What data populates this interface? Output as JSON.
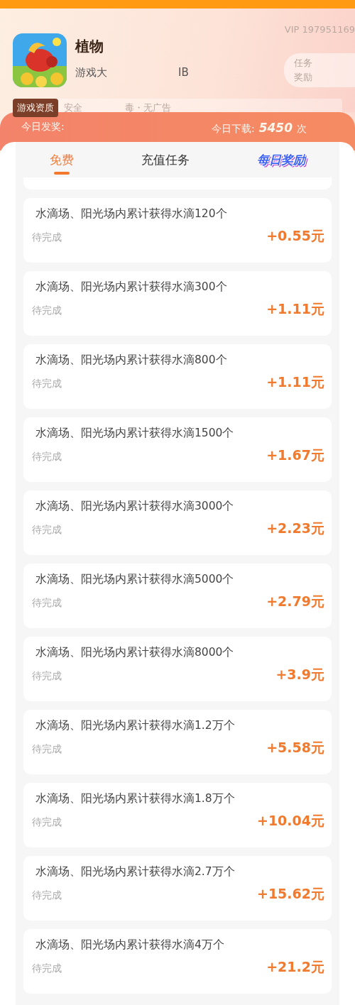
{
  "app": {
    "name": "植物",
    "subtitle_left": "游戏大",
    "subtitle_right": "IB",
    "vip": "VIP 197951169",
    "task_button": [
      "任务",
      "奖励"
    ]
  },
  "quality": {
    "label": "游戏资质",
    "left": "安全",
    "right": "毒・无广告"
  },
  "stats": {
    "award_label": "今日发奖:",
    "download_label": "今日下载:",
    "download_value": "5450",
    "download_unit": "次"
  },
  "tabs": [
    {
      "label": "免费",
      "selected": true,
      "kind": "plain"
    },
    {
      "label": "充值任务",
      "selected": false,
      "kind": "plain"
    },
    {
      "label": "每日奖励",
      "selected": false,
      "kind": "badge"
    }
  ],
  "tasks": [
    {
      "title": "水滴场、阳光场内累计获得水滴120个",
      "status": "待完成",
      "reward": "+0.55元"
    },
    {
      "title": "水滴场、阳光场内累计获得水滴300个",
      "status": "待完成",
      "reward": "+1.11元"
    },
    {
      "title": "水滴场、阳光场内累计获得水滴800个",
      "status": "待完成",
      "reward": "+1.11元"
    },
    {
      "title": "水滴场、阳光场内累计获得水滴1500个",
      "status": "待完成",
      "reward": "+1.67元"
    },
    {
      "title": "水滴场、阳光场内累计获得水滴3000个",
      "status": "待完成",
      "reward": "+2.23元"
    },
    {
      "title": "水滴场、阳光场内累计获得水滴5000个",
      "status": "待完成",
      "reward": "+2.79元"
    },
    {
      "title": "水滴场、阳光场内累计获得水滴8000个",
      "status": "待完成",
      "reward": "+3.9元"
    },
    {
      "title": "水滴场、阳光场内累计获得水滴1.2万个",
      "status": "待完成",
      "reward": "+5.58元"
    },
    {
      "title": "水滴场、阳光场内累计获得水滴1.8万个",
      "status": "待完成",
      "reward": "+10.04元"
    },
    {
      "title": "水滴场、阳光场内累计获得水滴2.7万个",
      "status": "待完成",
      "reward": "+15.62元"
    },
    {
      "title": "水滴场、阳光场内累计获得水滴4万个",
      "status": "待完成",
      "reward": "+21.2元"
    }
  ]
}
